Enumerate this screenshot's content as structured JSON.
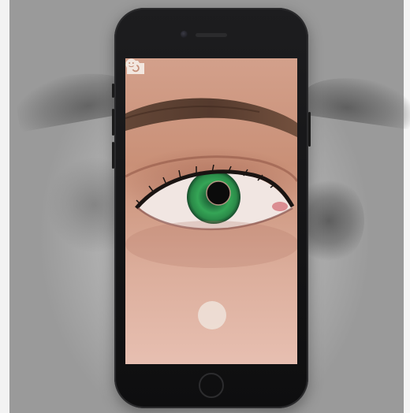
{
  "app": {
    "modes": [
      {
        "id": "eye",
        "icon": "eye-icon",
        "active": true
      },
      {
        "id": "photo",
        "icon": "camera-icon",
        "active": false
      },
      {
        "id": "face",
        "icon": "face-icon",
        "active": false
      }
    ],
    "shutter": {
      "icon": "shutter-button"
    },
    "colors": {
      "active_mode": "#2fc24a",
      "inactive_mode": "#f2e7df",
      "shutter": "#efe3da",
      "phone_body": "#111113",
      "background": "#b3b3b3"
    }
  },
  "viewfinder": {
    "subject": "eye-closeup",
    "iris_color": "#2f9a4f",
    "skin_color": "#d6a58e"
  }
}
